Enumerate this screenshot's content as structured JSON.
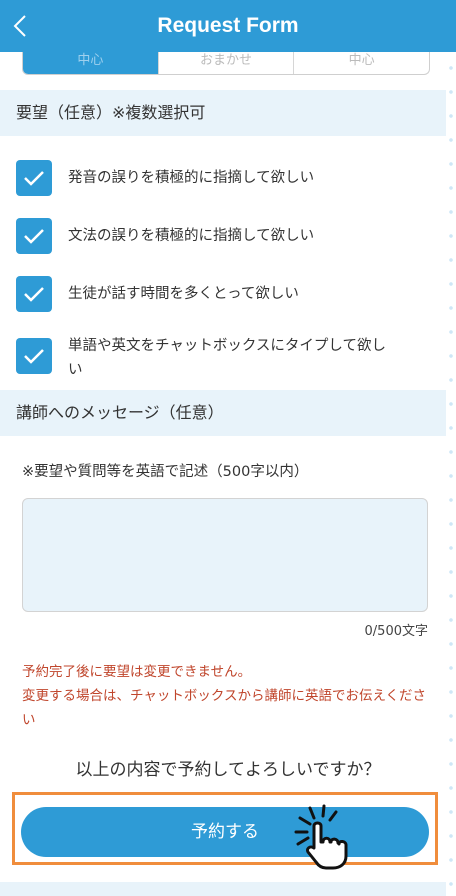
{
  "header": {
    "title": "Request Form",
    "back_icon": "chevron-left-icon"
  },
  "segment": {
    "options": [
      "中心",
      "おまかせ",
      "中心"
    ],
    "selected_index": 0
  },
  "requests": {
    "title": "要望（任意）※複数選択可",
    "items": [
      {
        "label": "発音の誤りを積極的に指摘して欲しい",
        "checked": true
      },
      {
        "label": "文法の誤りを積極的に指摘して欲しい",
        "checked": true
      },
      {
        "label": "生徒が話す時間を多くとって欲しい",
        "checked": true
      },
      {
        "label": "単語や英文をチャットボックスにタイプして欲しい",
        "checked": true
      }
    ]
  },
  "message": {
    "title": "講師へのメッセージ（任意）",
    "hint": "※要望や質問等を英語で記述（500字以内）",
    "value": "",
    "counter": "0/500文字"
  },
  "warning": "予約完了後に要望は変更できません。\n変更する場合は、チャットボックスから講師に英語でお伝えください",
  "confirm_text": "以上の内容で予約してよろしいですか？",
  "reserve_button": "予約する",
  "colors": {
    "primary": "#2e9bd6",
    "section_bg": "#e8f3fa",
    "warning": "#c0462c",
    "highlight": "#f08d3c"
  }
}
